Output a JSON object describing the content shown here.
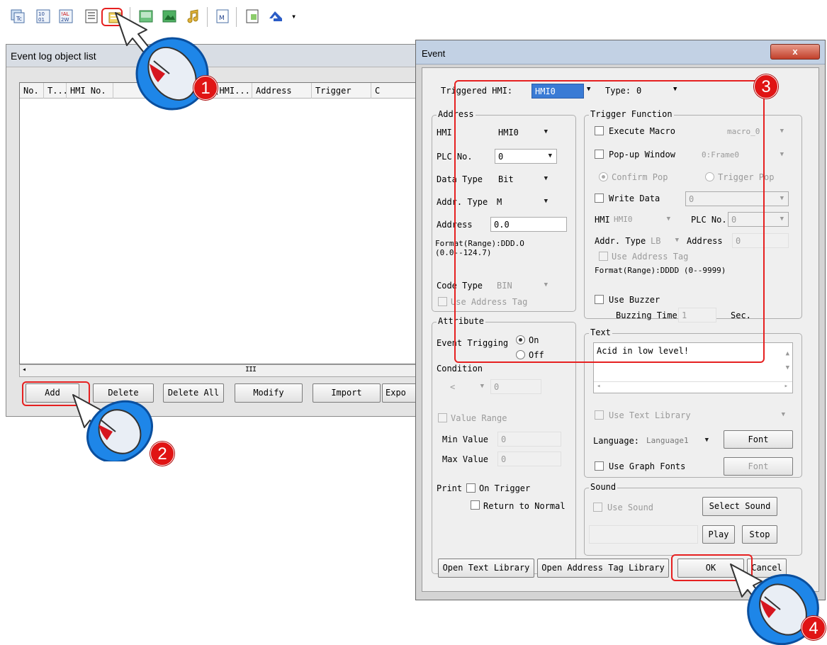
{
  "toolbar": {
    "icons": [
      "tag-table-icon",
      "binary-data-icon",
      "alarm-word-icon",
      "event-log-icon",
      "recipe-icon",
      "picture-icon",
      "bitmap-icon",
      "music-note-icon",
      "macro-icon",
      "document-icon",
      "transfer-icon"
    ],
    "overflow": "▾"
  },
  "list_window": {
    "title": "Event log object list",
    "columns": [
      "No.",
      "T...",
      "HMI No.",
      "o(HMI...",
      "Address",
      "Trigger",
      "C"
    ],
    "scroll_mark": "III",
    "buttons": [
      "Add",
      "Delete",
      "Delete All",
      "Modify",
      "Import",
      "Expo"
    ]
  },
  "dialog": {
    "title": "Event",
    "close_label": "x",
    "triggered_hmi_label": "Triggered HMI:",
    "triggered_hmi_value": "HMI0",
    "type_label": "Type:",
    "type_value": "0",
    "address": {
      "group_title": "Address",
      "hmi_label": "HMI",
      "hmi_value": "HMI0",
      "plc_no_label": "PLC No.",
      "plc_no_value": "0",
      "data_type_label": "Data Type",
      "data_type_value": "Bit",
      "addr_type_label": "Addr. Type",
      "addr_type_value": "M",
      "address_label": "Address",
      "address_value": "0.0",
      "format_line1": "Format(Range):DDD.O",
      "format_line2": "(0.0--124.7)",
      "code_type_label": "Code Type",
      "code_type_value": "BIN",
      "use_address_tag": "Use Address Tag"
    },
    "trigger": {
      "group_title": "Trigger Function",
      "execute_macro": "Execute Macro",
      "macro_value": "macro_0",
      "popup_window": "Pop-up Window",
      "popup_value": "0:Frame0",
      "confirm_pop": "Confirm Pop",
      "trigger_pop": "Trigger Pop",
      "write_data": "Write Data",
      "write_value": "0",
      "hmi_label": "HMI",
      "hmi_value": "HMI0",
      "plc_no_label": "PLC No.",
      "plc_no_value": "0",
      "addr_type_label": "Addr. Type",
      "addr_type_value": "LB",
      "address_label": "Address",
      "address_value": "0",
      "use_address_tag": "Use Address Tag",
      "format": "Format(Range):DDDD (0--9999)",
      "use_buzzer": "Use Buzzer",
      "buzzing_time_label": "Buzzing Time",
      "buzzing_time_value": "1",
      "sec_label": "Sec."
    },
    "attribute": {
      "group_title": "Attribute",
      "event_trigging": "Event Trigging",
      "on": "On",
      "off": "Off",
      "condition": "Condition",
      "condition_op": "<",
      "condition_value": "0",
      "value_range": "Value Range",
      "min_label": "Min Value",
      "min_value": "0",
      "max_label": "Max Value",
      "max_value": "0",
      "print_label": "Print",
      "on_trigger": "On Trigger",
      "return_normal": "Return to Normal"
    },
    "text": {
      "group_title": "Text",
      "content": "Acid in low level!",
      "use_text_library": "Use Text Library",
      "language_label": "Language:",
      "language_value": "Language1",
      "font_button": "Font",
      "use_graph_fonts": "Use Graph Fonts",
      "font_button2": "Font"
    },
    "sound": {
      "group_title": "Sound",
      "use_sound": "Use Sound",
      "select_sound": "Select Sound",
      "play": "Play",
      "stop": "Stop"
    },
    "buttons": {
      "open_text_library": "Open Text Library",
      "open_address_tag_library": "Open Address Tag Library",
      "ok": "OK",
      "cancel": "Cancel"
    }
  },
  "steps": [
    "1",
    "2",
    "3",
    "4"
  ],
  "colors": {
    "highlight": "#e62020",
    "mouse_body": "#1e86e8"
  }
}
